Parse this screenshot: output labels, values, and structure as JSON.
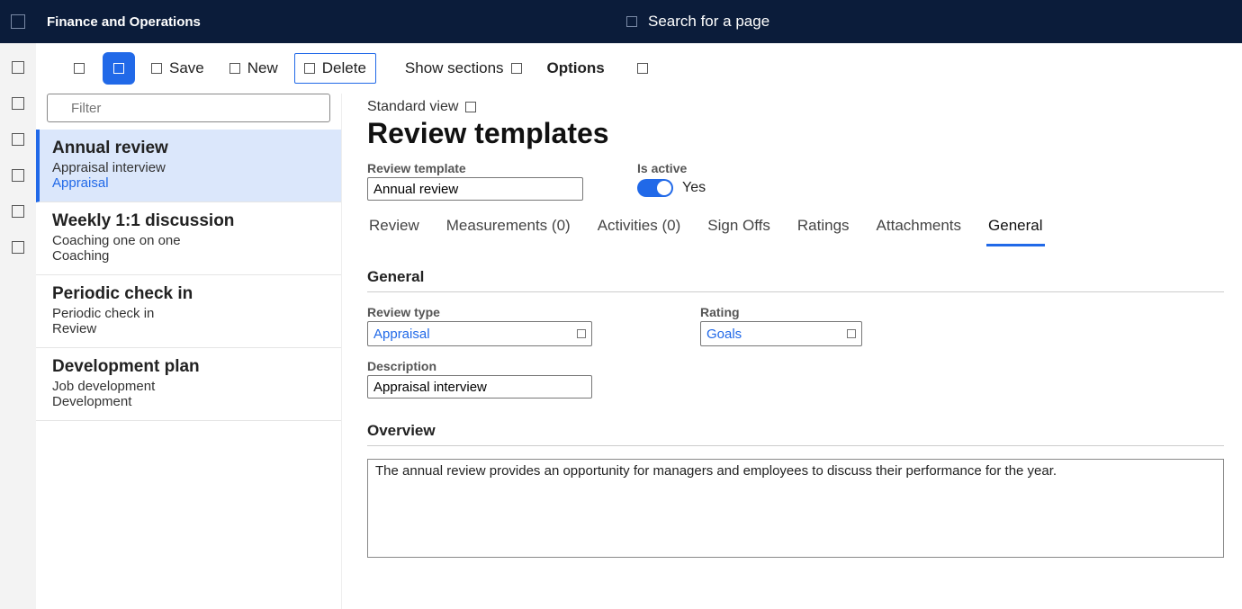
{
  "app": {
    "title": "Finance and Operations"
  },
  "search": {
    "placeholder": "Search for a page"
  },
  "actionbar": {
    "save": "Save",
    "new": "New",
    "delete": "Delete",
    "show_sections": "Show sections",
    "options": "Options"
  },
  "filter": {
    "placeholder": "Filter"
  },
  "list": {
    "items": [
      {
        "title": "Annual review",
        "sub1": "Appraisal interview",
        "sub2": "Appraisal",
        "active": true
      },
      {
        "title": "Weekly 1:1 discussion",
        "sub1": "Coaching one on one",
        "sub2": "Coaching",
        "active": false
      },
      {
        "title": "Periodic check in",
        "sub1": "Periodic check in",
        "sub2": "Review",
        "active": false
      },
      {
        "title": "Development plan",
        "sub1": "Job development",
        "sub2": "Development",
        "active": false
      }
    ]
  },
  "detail": {
    "standard_view": "Standard view",
    "page_title": "Review templates",
    "review_template_label": "Review template",
    "review_template_value": "Annual review",
    "is_active_label": "Is active",
    "is_active_value": "Yes",
    "tabs": {
      "review": "Review",
      "measurements": "Measurements (0)",
      "activities": "Activities (0)",
      "signoffs": "Sign Offs",
      "ratings": "Ratings",
      "attachments": "Attachments",
      "general": "General"
    },
    "general": {
      "section_title": "General",
      "review_type_label": "Review type",
      "review_type_value": "Appraisal",
      "rating_label": "Rating",
      "rating_value": "Goals",
      "description_label": "Description",
      "description_value": "Appraisal interview"
    },
    "overview": {
      "title": "Overview",
      "text": "The annual review provides an opportunity for managers and employees to discuss their performance for the year."
    }
  }
}
